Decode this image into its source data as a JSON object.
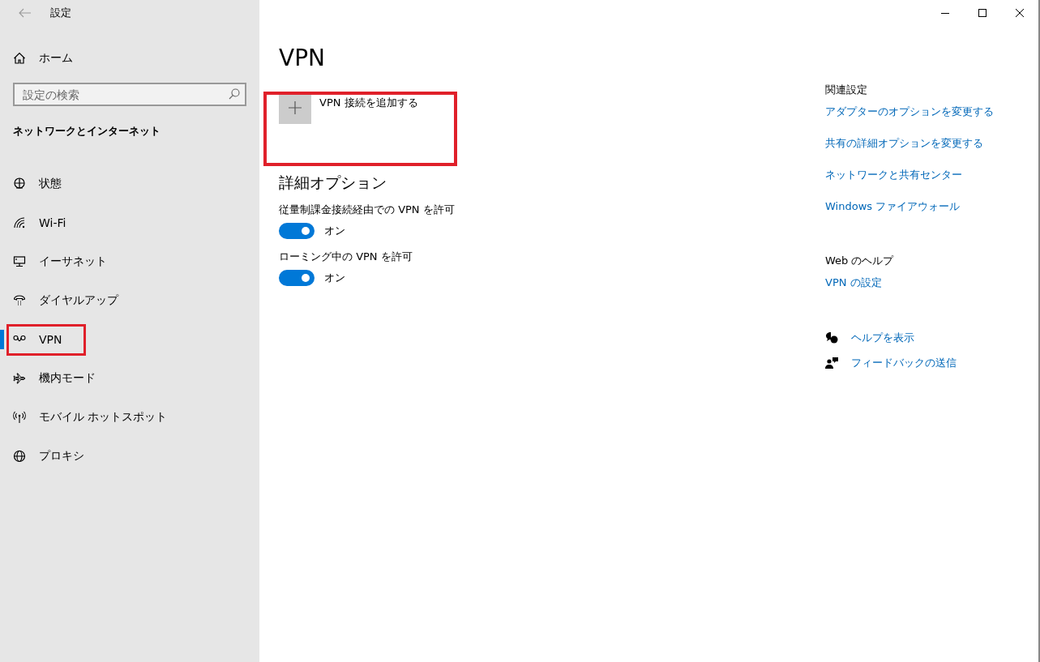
{
  "window": {
    "title": "設定"
  },
  "sidebar": {
    "home": "ホーム",
    "search": {
      "placeholder": "設定の検索"
    },
    "section": "ネットワークとインターネット",
    "items": [
      {
        "label": "状態",
        "selected": false,
        "highlighted": false
      },
      {
        "label": "Wi-Fi",
        "selected": false,
        "highlighted": false
      },
      {
        "label": "イーサネット",
        "selected": false,
        "highlighted": false
      },
      {
        "label": "ダイヤルアップ",
        "selected": false,
        "highlighted": false
      },
      {
        "label": "VPN",
        "selected": true,
        "highlighted": true
      },
      {
        "label": "機内モード",
        "selected": false,
        "highlighted": false
      },
      {
        "label": "モバイル ホットスポット",
        "selected": false,
        "highlighted": false
      },
      {
        "label": "プロキシ",
        "selected": false,
        "highlighted": false
      }
    ]
  },
  "main": {
    "title": "VPN",
    "add_button": {
      "label": "VPN 接続を追加する",
      "highlighted": true
    },
    "advanced_heading": "詳細オプション",
    "options": [
      {
        "label": "従量制課金接続経由での VPN を許可",
        "on": true,
        "state_text": "オン"
      },
      {
        "label": "ローミング中の VPN を許可",
        "on": true,
        "state_text": "オン"
      }
    ]
  },
  "related": {
    "heading": "関連設定",
    "links": [
      "アダプターのオプションを変更する",
      "共有の詳細オプションを変更する",
      "ネットワークと共有センター",
      "Windows ファイアウォール"
    ],
    "web_help_heading": "Web のヘルプ",
    "web_help_links": [
      "VPN の設定"
    ],
    "help_actions": [
      "ヘルプを表示",
      "フィードバックの送信"
    ]
  }
}
